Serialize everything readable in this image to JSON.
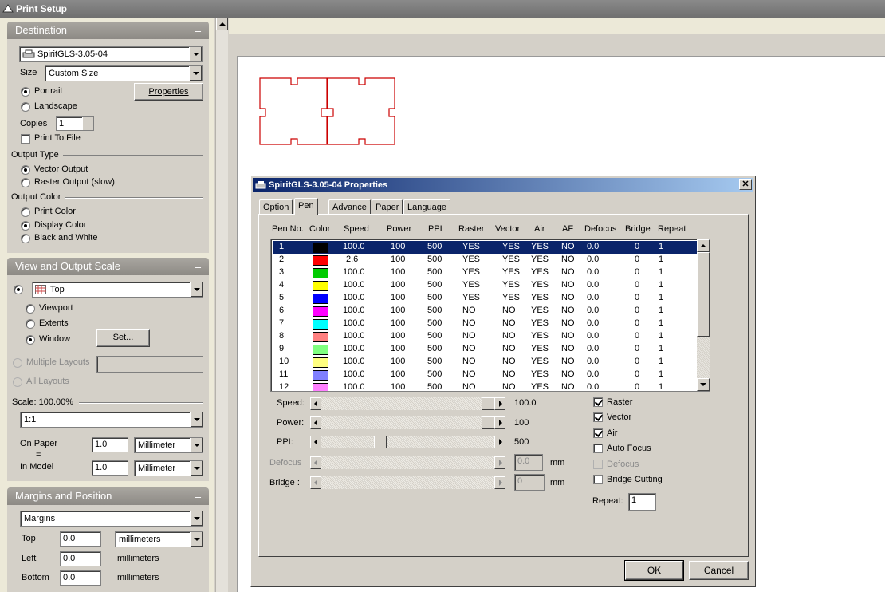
{
  "app": {
    "title": "Print Setup"
  },
  "destination": {
    "header": "Destination",
    "collapse": "–",
    "printer": "SpiritGLS-3.05-04",
    "size_label": "Size",
    "size_value": "Custom Size",
    "portrait": "Portrait",
    "landscape": "Landscape",
    "properties_button": "Properties",
    "copies_label": "Copies",
    "copies_value": "1",
    "print_to_file": "Print To File",
    "output_type_label": "Output Type",
    "vector_output": "Vector Output",
    "raster_output": "Raster Output (slow)",
    "output_color_label": "Output Color",
    "print_color": "Print Color",
    "display_color": "Display Color",
    "black_white": "Black and White"
  },
  "view_scale": {
    "header": "View and Output Scale",
    "collapse": "–",
    "view_value": "Top",
    "viewport": "Viewport",
    "extents": "Extents",
    "window": "Window",
    "set_button": "Set...",
    "multiple_layouts": "Multiple Layouts",
    "all_layouts": "All Layouts",
    "scale_label": "Scale:  100.00%",
    "scale_value": "1:1",
    "on_paper_label": "On Paper",
    "equals": "=",
    "in_model_label": "In Model",
    "on_paper_value": "1.0",
    "on_paper_unit": "Millimeter",
    "in_model_value": "1.0",
    "in_model_unit": "Millimeter"
  },
  "margins": {
    "header": "Margins and Position",
    "collapse": "–",
    "mode_value": "Margins",
    "top_label": "Top",
    "top_value": "0.0",
    "top_unit": "millimeters",
    "left_label": "Left",
    "left_value": "0.0",
    "left_unit": "millimeters",
    "bottom_label": "Bottom",
    "bottom_value": "0.0",
    "bottom_unit": "millimeters"
  },
  "dialog": {
    "title": "SpiritGLS-3.05-04 Properties",
    "close": "✕",
    "tabs": [
      "Option",
      "Pen",
      "Advance",
      "Paper",
      "Language"
    ],
    "active_tab": "Pen",
    "columns": [
      "Pen No.",
      "Color",
      "Speed",
      "Power",
      "PPI",
      "Raster",
      "Vector",
      "Air",
      "AF",
      "Defocus",
      "Bridge",
      "Repeat"
    ],
    "pens": [
      {
        "no": "1",
        "color": "#000000",
        "speed": "100.0",
        "power": "100",
        "ppi": "500",
        "raster": "YES",
        "vector": "YES",
        "air": "YES",
        "af": "NO",
        "defocus": "0.0",
        "bridge": "0",
        "repeat": "1"
      },
      {
        "no": "2",
        "color": "#ff0000",
        "speed": "2.6",
        "power": "100",
        "ppi": "500",
        "raster": "YES",
        "vector": "YES",
        "air": "YES",
        "af": "NO",
        "defocus": "0.0",
        "bridge": "0",
        "repeat": "1"
      },
      {
        "no": "3",
        "color": "#00cc00",
        "speed": "100.0",
        "power": "100",
        "ppi": "500",
        "raster": "YES",
        "vector": "YES",
        "air": "YES",
        "af": "NO",
        "defocus": "0.0",
        "bridge": "0",
        "repeat": "1"
      },
      {
        "no": "4",
        "color": "#ffff00",
        "speed": "100.0",
        "power": "100",
        "ppi": "500",
        "raster": "YES",
        "vector": "YES",
        "air": "YES",
        "af": "NO",
        "defocus": "0.0",
        "bridge": "0",
        "repeat": "1"
      },
      {
        "no": "5",
        "color": "#0000ff",
        "speed": "100.0",
        "power": "100",
        "ppi": "500",
        "raster": "YES",
        "vector": "YES",
        "air": "YES",
        "af": "NO",
        "defocus": "0.0",
        "bridge": "0",
        "repeat": "1"
      },
      {
        "no": "6",
        "color": "#ff00ff",
        "speed": "100.0",
        "power": "100",
        "ppi": "500",
        "raster": "NO",
        "vector": "NO",
        "air": "YES",
        "af": "NO",
        "defocus": "0.0",
        "bridge": "0",
        "repeat": "1"
      },
      {
        "no": "7",
        "color": "#00ffff",
        "speed": "100.0",
        "power": "100",
        "ppi": "500",
        "raster": "NO",
        "vector": "NO",
        "air": "YES",
        "af": "NO",
        "defocus": "0.0",
        "bridge": "0",
        "repeat": "1"
      },
      {
        "no": "8",
        "color": "#ff8080",
        "speed": "100.0",
        "power": "100",
        "ppi": "500",
        "raster": "NO",
        "vector": "NO",
        "air": "YES",
        "af": "NO",
        "defocus": "0.0",
        "bridge": "0",
        "repeat": "1"
      },
      {
        "no": "9",
        "color": "#80ff80",
        "speed": "100.0",
        "power": "100",
        "ppi": "500",
        "raster": "NO",
        "vector": "NO",
        "air": "YES",
        "af": "NO",
        "defocus": "0.0",
        "bridge": "0",
        "repeat": "1"
      },
      {
        "no": "10",
        "color": "#ffff80",
        "speed": "100.0",
        "power": "100",
        "ppi": "500",
        "raster": "NO",
        "vector": "NO",
        "air": "YES",
        "af": "NO",
        "defocus": "0.0",
        "bridge": "0",
        "repeat": "1"
      },
      {
        "no": "11",
        "color": "#8080ff",
        "speed": "100.0",
        "power": "100",
        "ppi": "500",
        "raster": "NO",
        "vector": "NO",
        "air": "YES",
        "af": "NO",
        "defocus": "0.0",
        "bridge": "0",
        "repeat": "1"
      },
      {
        "no": "12",
        "color": "#ff80ff",
        "speed": "100.0",
        "power": "100",
        "ppi": "500",
        "raster": "NO",
        "vector": "NO",
        "air": "YES",
        "af": "NO",
        "defocus": "0.0",
        "bridge": "0",
        "repeat": "1"
      }
    ],
    "selected_pen": "1",
    "sliders": {
      "speed_label": "Speed:",
      "speed_value": "100.0",
      "speed_level": 1.0,
      "power_label": "Power:",
      "power_value": "100",
      "power_level": 1.0,
      "ppi_label": "PPI:",
      "ppi_value": "500",
      "ppi_level": 0.33,
      "defocus_label": "Defocus",
      "defocus_value": "0.0",
      "defocus_unit": "mm",
      "bridge_label": "Bridge :",
      "bridge_value": "0",
      "bridge_unit": "mm"
    },
    "checks": {
      "raster": "Raster",
      "vector": "Vector",
      "air": "Air",
      "auto_focus": "Auto Focus",
      "defocus": "Defocus",
      "bridge_cutting": "Bridge Cutting"
    },
    "repeat_label": "Repeat:",
    "repeat_value": "1",
    "ok": "OK",
    "cancel": "Cancel"
  },
  "colors": {
    "preview_line": "#cc0000",
    "selection": "#0a246a"
  }
}
